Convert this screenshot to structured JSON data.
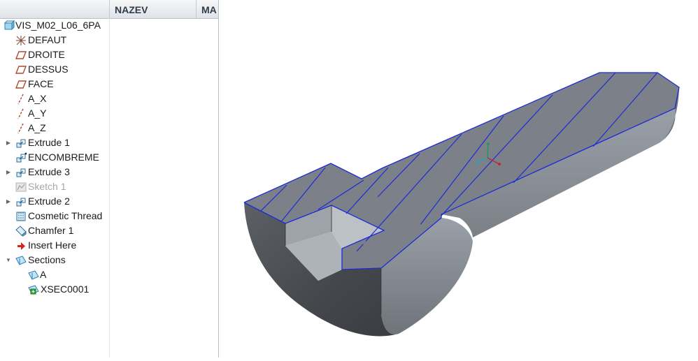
{
  "tree": {
    "columns": [
      "NAZEV",
      "MA"
    ],
    "items": [
      {
        "label": "VIS_M02_L06_6PA",
        "icon": "part-icon"
      },
      {
        "label": "DEFAUT",
        "icon": "coordinate-system-icon"
      },
      {
        "label": "DROITE",
        "icon": "datum-plane-icon"
      },
      {
        "label": "DESSUS",
        "icon": "datum-plane-icon"
      },
      {
        "label": "FACE",
        "icon": "datum-plane-icon"
      },
      {
        "label": "A_X",
        "icon": "datum-axis-icon"
      },
      {
        "label": "A_Y",
        "icon": "datum-axis-icon"
      },
      {
        "label": "A_Z",
        "icon": "datum-axis-icon"
      },
      {
        "label": "Extrude 1",
        "icon": "extrude-icon",
        "expandable": true
      },
      {
        "label": "ENCOMBREME",
        "icon": "extrude-icon"
      },
      {
        "label": "Extrude 3",
        "icon": "extrude-icon",
        "expandable": true
      },
      {
        "label": "Sketch 1",
        "icon": "sketch-icon",
        "disabled": true
      },
      {
        "label": "Extrude 2",
        "icon": "extrude-icon",
        "expandable": true
      },
      {
        "label": "Cosmetic Thread",
        "icon": "cosmetic-thread-icon"
      },
      {
        "label": "Chamfer 1",
        "icon": "chamfer-icon"
      },
      {
        "label": "Insert Here",
        "icon": "insert-arrow-icon"
      },
      {
        "label": "Sections",
        "icon": "sections-icon",
        "expanded": true
      },
      {
        "label": "A",
        "icon": "section-icon"
      },
      {
        "label": "XSEC0001",
        "icon": "xsec-icon"
      }
    ]
  },
  "model": {
    "body_color": "#7a7f87",
    "face_top_color": "#7b8088",
    "face_dark_color": "#4b4e53",
    "edge_color": "#1c2bd6"
  }
}
